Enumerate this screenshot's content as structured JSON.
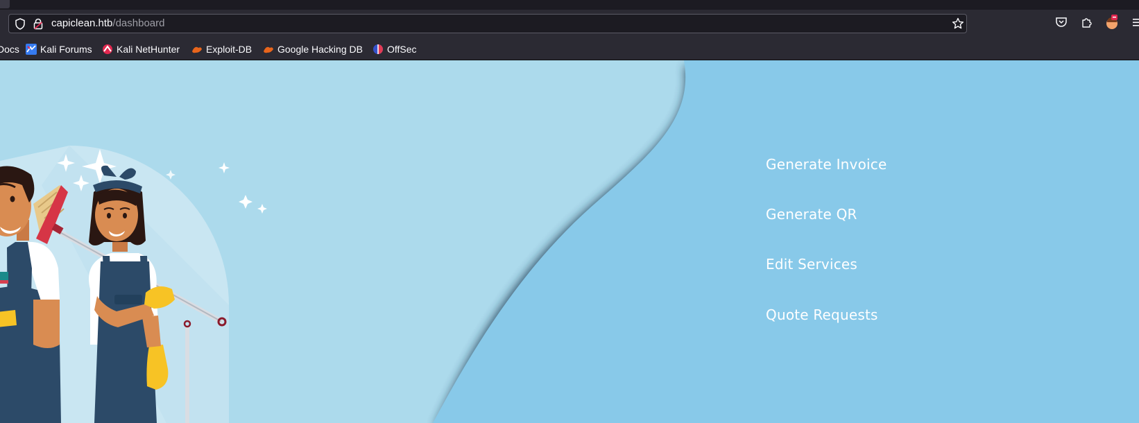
{
  "browser": {
    "url": {
      "host": "capiclean.htb",
      "path": "/dashboard"
    },
    "bookmarks": [
      {
        "label": "Docs"
      },
      {
        "label": "Kali Forums"
      },
      {
        "label": "Kali NetHunter"
      },
      {
        "label": "Exploit-DB"
      },
      {
        "label": "Google Hacking DB"
      },
      {
        "label": "OffSec"
      }
    ],
    "icons": [
      "shield-icon",
      "lock-icon",
      "star-icon",
      "pocket-icon",
      "extensions-icon",
      "profile-avatar-icon",
      "menu-icon"
    ]
  },
  "dashboard": {
    "menu": [
      {
        "label": "Generate Invoice"
      },
      {
        "label": "Generate QR"
      },
      {
        "label": "Edit Services"
      },
      {
        "label": "Quote Requests"
      }
    ]
  },
  "colors": {
    "page_left": "#acdaec",
    "page_right": "#88c9e9",
    "shadow": "#1d3a52",
    "overalls": "#2c4a68",
    "gloves": "#f7c325",
    "browser_chrome": "#2b2a33"
  }
}
